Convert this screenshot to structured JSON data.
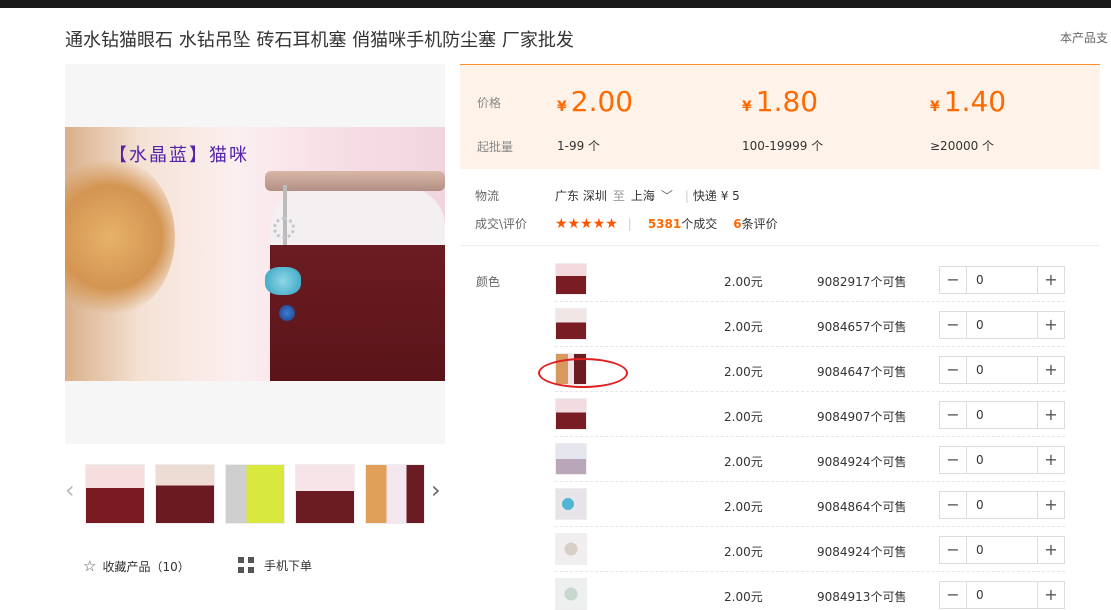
{
  "product": {
    "title": "通水钻猫眼石 水钻吊坠 砖石耳机塞 俏猫咪手机防尘塞 厂家批发",
    "support_text": "本产品支"
  },
  "gallery": {
    "caption": "【水晶蓝】猫咪",
    "prev_arrow": "‹",
    "next_arrow": "›",
    "thumbnails": [
      "thumb-1",
      "thumb-2",
      "thumb-3",
      "thumb-4",
      "thumb-5"
    ]
  },
  "actions": {
    "favorite_icon": "☆",
    "favorite_label": "收藏产品（10）",
    "mobile_label": "手机下单"
  },
  "pricing": {
    "price_label": "价格",
    "moq_label": "起批量",
    "currency": "¥",
    "tiers": [
      {
        "price": "2.00",
        "range": "1-99 个"
      },
      {
        "price": "1.80",
        "range": "100-19999 个"
      },
      {
        "price": "1.40",
        "range": "≥20000 个"
      }
    ]
  },
  "logistics": {
    "label": "物流",
    "origin": "广东 深圳",
    "to_word": "至",
    "destination": "上海",
    "chevron": "﹀",
    "shipping": "快递 ¥ 5"
  },
  "reviews": {
    "label": "成交\\评价",
    "stars": "★★★★★",
    "bar": "|",
    "deals_count": "5381",
    "deals_label": "个成交",
    "reviews_count": "6",
    "reviews_label": "条评价"
  },
  "sku": {
    "label": "颜色",
    "minus": "−",
    "plus": "+",
    "items": [
      {
        "price": "2.00元",
        "stock": "9082917个可售",
        "qty": "0"
      },
      {
        "price": "2.00元",
        "stock": "9084657个可售",
        "qty": "0"
      },
      {
        "price": "2.00元",
        "stock": "9084647个可售",
        "qty": "0"
      },
      {
        "price": "2.00元",
        "stock": "9084907个可售",
        "qty": "0"
      },
      {
        "price": "2.00元",
        "stock": "9084924个可售",
        "qty": "0"
      },
      {
        "price": "2.00元",
        "stock": "9084864个可售",
        "qty": "0"
      },
      {
        "price": "2.00元",
        "stock": "9084924个可售",
        "qty": "0"
      },
      {
        "price": "2.00元",
        "stock": "9084913个可售",
        "qty": "0"
      }
    ]
  },
  "colors": {
    "accent": "#ff6a00",
    "price_bg": "#fff2e8",
    "highlight": "#e02020"
  }
}
